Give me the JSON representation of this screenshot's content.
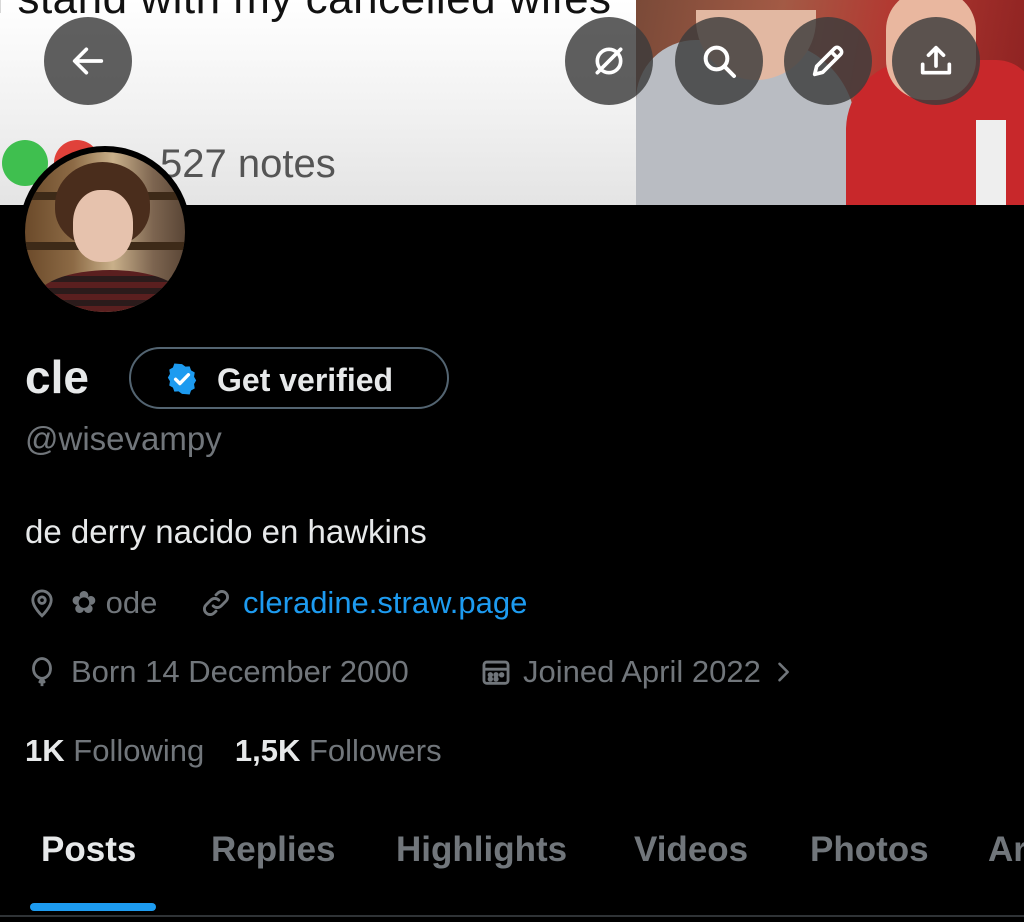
{
  "banner": {
    "caption": "I stand with my cancelled wifes",
    "notes": "527 notes"
  },
  "header_buttons": [
    {
      "name": "back-arrow-icon",
      "kind": "back"
    },
    {
      "name": "crossed-circle-icon",
      "kind": "grok"
    },
    {
      "name": "search-icon",
      "kind": "search"
    },
    {
      "name": "pencil-icon",
      "kind": "edit"
    },
    {
      "name": "share-icon",
      "kind": "share"
    }
  ],
  "profile": {
    "display_name": "cle",
    "verify_label": "Get verified",
    "handle": "@wisevampy",
    "bio": "de derry nacido en hawkins",
    "location": "✿ ode",
    "website": "cleradine.straw.page",
    "birthday": "Born 14 December 2000",
    "joined": "Joined April 2022",
    "following_count": "1K",
    "following_label": "Following",
    "followers_count": "1,5K",
    "followers_label": "Followers"
  },
  "tabs": [
    {
      "label": "Posts",
      "active": true
    },
    {
      "label": "Replies",
      "active": false
    },
    {
      "label": "Highlights",
      "active": false
    },
    {
      "label": "Videos",
      "active": false
    },
    {
      "label": "Photos",
      "active": false
    },
    {
      "label": "Articles",
      "active": false
    }
  ],
  "colors": {
    "background": "#000000",
    "text_primary": "#e7e9ea",
    "text_secondary": "#71767b",
    "accent": "#1d9bf0"
  }
}
